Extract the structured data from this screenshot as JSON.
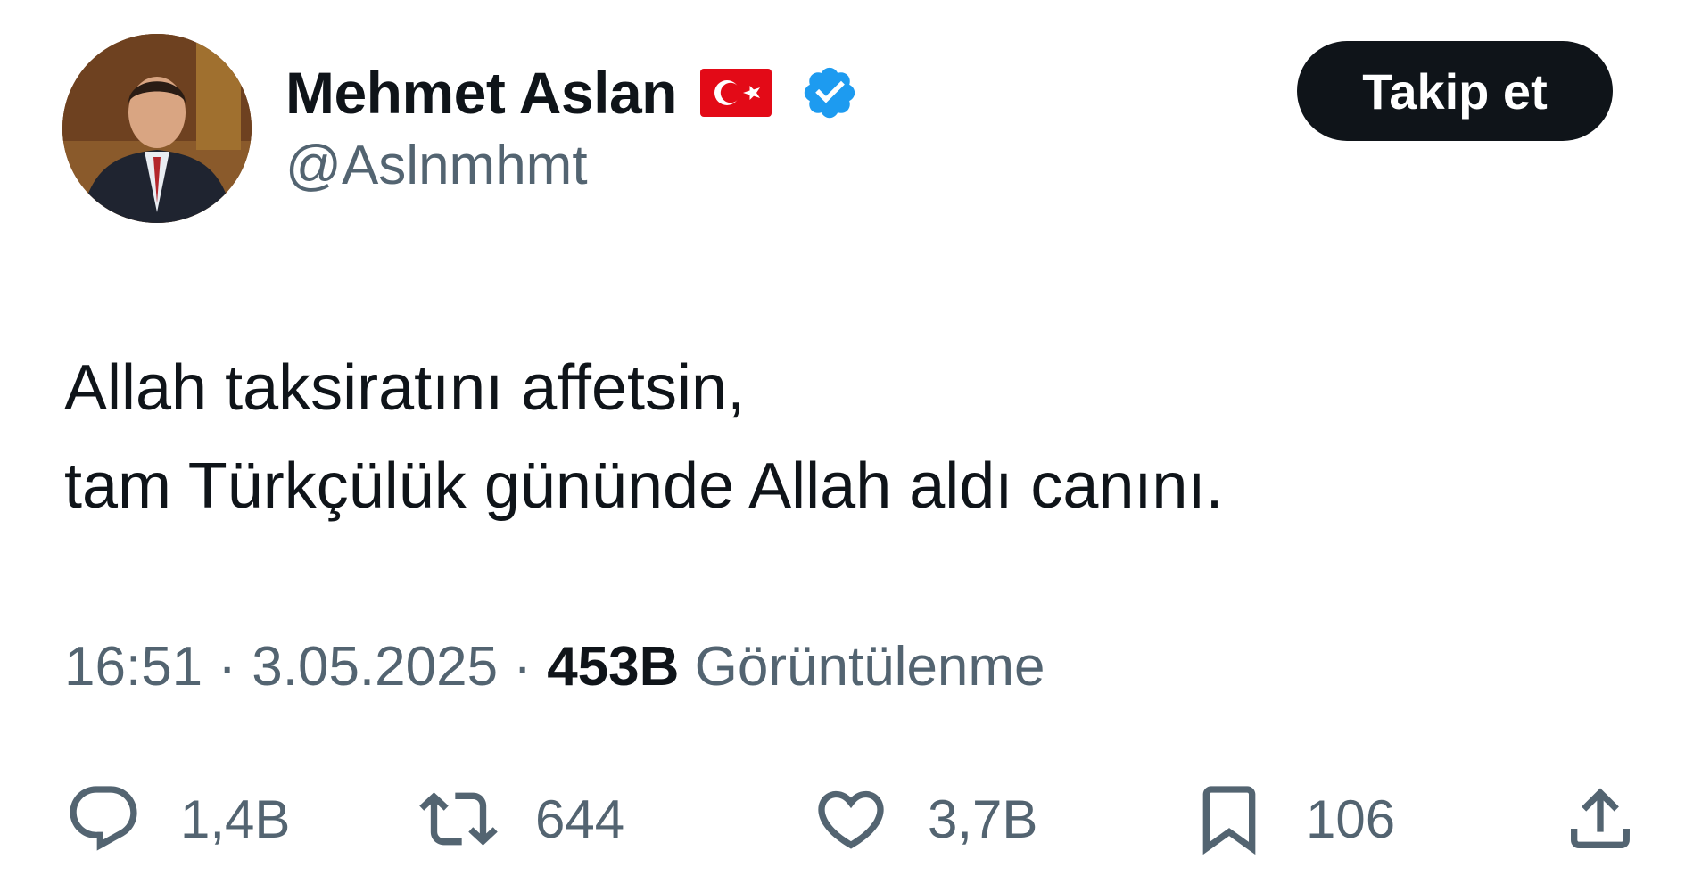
{
  "author": {
    "display_name": "Mehmet Aslan",
    "handle": "@Aslnmhmt",
    "flag_icon": "turkey-flag-icon",
    "verified_icon": "verified-badge-icon",
    "verified_color": "#1d9bf0"
  },
  "follow_button": {
    "label": "Takip et"
  },
  "tweet": {
    "lines": [
      "Allah taksiratını affetsin,",
      "tam Türkçülük gününde Allah aldı canını."
    ]
  },
  "meta": {
    "time": "16:51",
    "separator": " · ",
    "date": "3.05.2025",
    "views_count": "453B",
    "views_label": " Görüntülenme"
  },
  "actions": {
    "replies": {
      "icon": "reply-icon",
      "count": "1,4B"
    },
    "retweets": {
      "icon": "retweet-icon",
      "count": "644"
    },
    "likes": {
      "icon": "heart-icon",
      "count": "3,7B"
    },
    "bookmarks": {
      "icon": "bookmark-icon",
      "count": "106"
    },
    "share": {
      "icon": "share-icon"
    }
  },
  "colors": {
    "text_primary": "#0f1419",
    "text_secondary": "#536471",
    "button_bg": "#0f1419",
    "flag_red": "#e30a17"
  }
}
